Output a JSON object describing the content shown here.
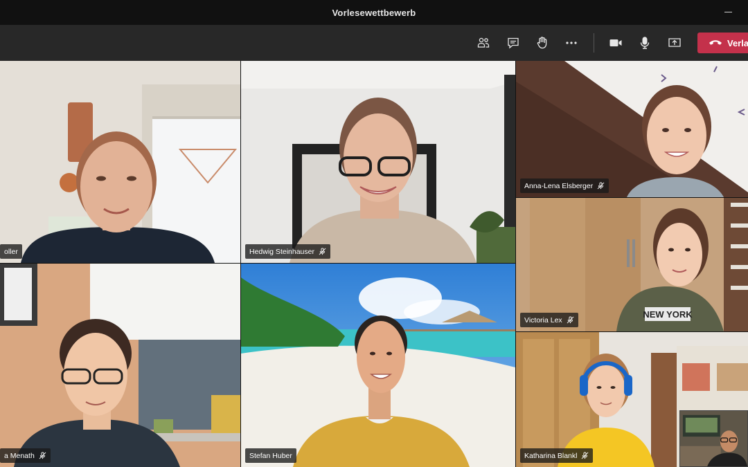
{
  "window": {
    "title": "Vorlesewettbewerb"
  },
  "toolbar": {
    "icons": [
      "participants-icon",
      "chat-icon",
      "raise-hand-icon",
      "more-options-icon",
      "camera-icon",
      "microphone-icon",
      "share-screen-icon",
      "phone-hangup-icon"
    ],
    "leave_label": "Verla",
    "leave_color": "#c4314b"
  },
  "participants": [
    {
      "name": "oller",
      "muted": false
    },
    {
      "name": "Hedwig Steinhauser",
      "muted": true
    },
    {
      "name": "Anna-Lena Elsberger",
      "muted": true
    },
    {
      "name": "Victoria Lex",
      "muted": true
    },
    {
      "name": "a Menath",
      "muted": true
    },
    {
      "name": "Stefan Huber",
      "muted": false
    },
    {
      "name": "Katharina Blankl",
      "muted": true
    }
  ]
}
